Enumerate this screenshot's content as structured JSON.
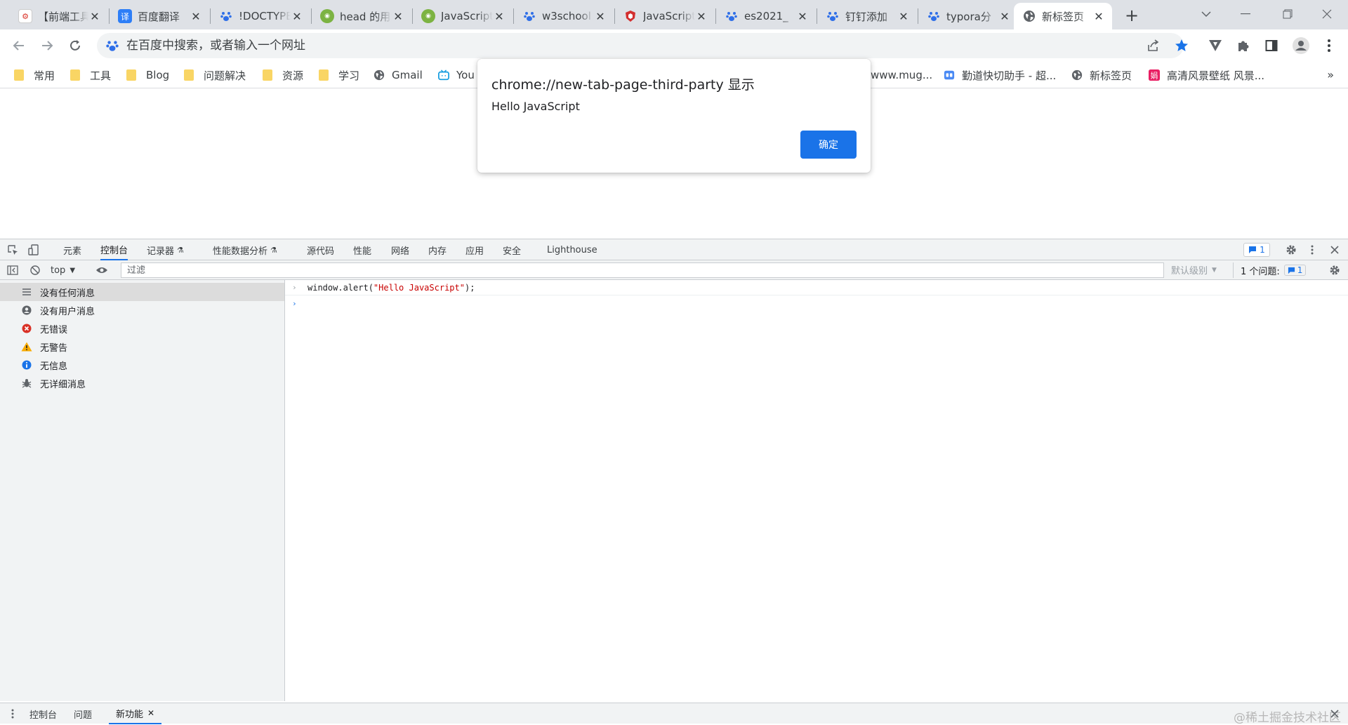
{
  "tabs": [
    {
      "title": "【前端工具】",
      "icon": "tool-icon"
    },
    {
      "title": "百度翻译",
      "icon": "translate-icon"
    },
    {
      "title": "!DOCTYPE",
      "icon": "baidu-paw-icon"
    },
    {
      "title": "head 的用法",
      "icon": "green-logo-icon"
    },
    {
      "title": "JavaScript",
      "icon": "green-logo-icon"
    },
    {
      "title": "w3school",
      "icon": "baidu-paw-icon"
    },
    {
      "title": "JavaScript",
      "icon": "red-shield-icon"
    },
    {
      "title": "es2021_",
      "icon": "baidu-paw-icon"
    },
    {
      "title": "钉钉添加",
      "icon": "baidu-paw-icon"
    },
    {
      "title": "typora分",
      "icon": "baidu-paw-icon"
    },
    {
      "title": "新标签页",
      "icon": "globe-icon",
      "active": true
    }
  ],
  "omnibox": {
    "placeholder": "在百度中搜索，或者输入一个网址"
  },
  "bookmarks": [
    {
      "label": "常用",
      "type": "folder"
    },
    {
      "label": "工具",
      "type": "folder"
    },
    {
      "label": "Blog",
      "type": "folder"
    },
    {
      "label": "问题解决",
      "type": "folder"
    },
    {
      "label": "资源",
      "type": "folder"
    },
    {
      "label": "学习",
      "type": "folder"
    },
    {
      "label": "Gmail",
      "type": "globe"
    },
    {
      "label": "You",
      "type": "bili"
    },
    {
      "label": "www.mug...",
      "type": "none"
    },
    {
      "label": "勤道快切助手 - 超...",
      "type": "app"
    },
    {
      "label": "新标签页",
      "type": "globe"
    },
    {
      "label": "高清风景壁纸 风景...",
      "type": "pink"
    }
  ],
  "bookmarks_more": "»",
  "dialog": {
    "title": "chrome://new-tab-page-third-party 显示",
    "message": "Hello JavaScript",
    "ok_label": "确定"
  },
  "devtools": {
    "tabs": [
      {
        "label": "元素"
      },
      {
        "label": "控制台",
        "active": true
      },
      {
        "label": "记录器",
        "flask": true
      },
      {
        "label": "性能数据分析",
        "flask": true
      },
      {
        "label": "源代码"
      },
      {
        "label": "性能"
      },
      {
        "label": "网络"
      },
      {
        "label": "内存"
      },
      {
        "label": "应用"
      },
      {
        "label": "安全"
      },
      {
        "label": "Lighthouse"
      }
    ],
    "issues_badge": "1",
    "context": "top",
    "filter_placeholder": "过滤",
    "levels": "默认级别",
    "issue_label": "1 个问题:",
    "issue_count": "1",
    "sidebar": [
      {
        "label": "没有任何消息",
        "icon": "list-icon",
        "active": true
      },
      {
        "label": "没有用户消息",
        "icon": "user-icon"
      },
      {
        "label": "无错误",
        "icon": "error-icon"
      },
      {
        "label": "无警告",
        "icon": "warning-icon"
      },
      {
        "label": "无信息",
        "icon": "info-icon"
      },
      {
        "label": "无详细消息",
        "icon": "bug-icon"
      }
    ],
    "console": {
      "input_prefix": "window.alert(",
      "input_string": "\"Hello JavaScript\"",
      "input_suffix": ");"
    },
    "drawer_tabs": [
      {
        "label": "控制台"
      },
      {
        "label": "问题"
      },
      {
        "label": "新功能",
        "active": true,
        "closable": true
      }
    ]
  },
  "watermark": "@稀土掘金技术社区",
  "colors": {
    "accent": "#1a73e8",
    "tabstrip": "#dee1e6",
    "panel": "#f1f3f4",
    "string": "#c80000"
  }
}
